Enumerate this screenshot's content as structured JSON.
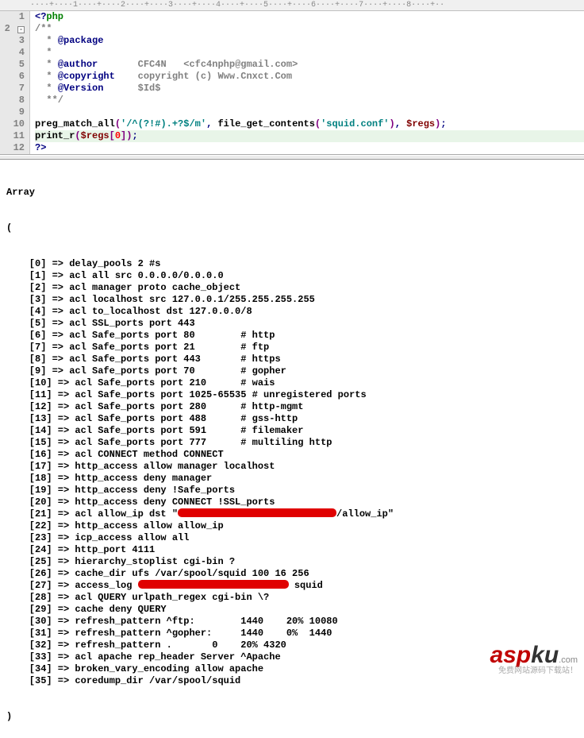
{
  "ruler": "····+····1····+····2····+····3····+····4····+····5····+····6····+····7····+····8····+··",
  "code_lines": [
    {
      "n": "1",
      "html": "<span class='c-op'>&lt;?</span><span class='c-kw'>php</span>"
    },
    {
      "n": "2",
      "fold": true,
      "html": "<span class='c-cmt'>/**</span>"
    },
    {
      "n": "3",
      "html": "<span class='c-cmt'>  * </span><span class='c-tag'>@package</span>"
    },
    {
      "n": "4",
      "html": "<span class='c-cmt'>  *</span>"
    },
    {
      "n": "5",
      "html": "<span class='c-cmt'>  * </span><span class='c-tag'>@author</span><span class='c-cmt'>       CFC4N   &lt;cfc4nphp@gmail.com&gt;</span>"
    },
    {
      "n": "6",
      "html": "<span class='c-cmt'>  * </span><span class='c-tag'>@copyright</span><span class='c-cmt'>    copyright (c) Www.Cnxct.Com</span>"
    },
    {
      "n": "7",
      "html": "<span class='c-cmt'>  * </span><span class='c-tag'>@Version</span><span class='c-cmt'>      $Id$</span>"
    },
    {
      "n": "8",
      "html": "<span class='c-cmt'>  **/</span>"
    },
    {
      "n": "9",
      "html": ""
    },
    {
      "n": "10",
      "html": "<span class='c-fn'>preg_match_all</span><span class='c-br'>(</span><span class='c-str'>'/^(?!#).+?$/m'</span><span class='c-op'>,</span> <span class='c-fn'>file_get_contents</span><span class='c-br'>(</span><span class='c-str'>'squid.conf'</span><span class='c-br'>)</span><span class='c-op'>,</span> <span class='c-var'>$regs</span><span class='c-br'>)</span><span class='c-op'>;</span>"
    },
    {
      "n": "11",
      "hl": true,
      "html": "<span class='c-fn'>print_r</span><span class='c-br'>(</span><span class='c-var'>$regs</span><span class='c-br'>[</span><span class='c-num'>0</span><span class='c-br'>])</span><span class='c-op'>;</span>"
    },
    {
      "n": "12",
      "html": "<span class='c-op'>?&gt;</span>"
    }
  ],
  "output": {
    "head1": "Array",
    "head2": "(",
    "rows": [
      {
        "idx": 0,
        "text": "delay_pools 2 #s"
      },
      {
        "idx": 1,
        "text": "acl all src 0.0.0.0/0.0.0.0"
      },
      {
        "idx": 2,
        "text": "acl manager proto cache_object"
      },
      {
        "idx": 3,
        "text": "acl localhost src 127.0.0.1/255.255.255.255"
      },
      {
        "idx": 4,
        "text": "acl to_localhost dst 127.0.0.0/8"
      },
      {
        "idx": 5,
        "text": "acl SSL_ports port 443"
      },
      {
        "idx": 6,
        "text": "acl Safe_ports port 80        # http"
      },
      {
        "idx": 7,
        "text": "acl Safe_ports port 21        # ftp"
      },
      {
        "idx": 8,
        "text": "acl Safe_ports port 443       # https"
      },
      {
        "idx": 9,
        "text": "acl Safe_ports port 70        # gopher"
      },
      {
        "idx": 10,
        "text": "acl Safe_ports port 210      # wais"
      },
      {
        "idx": 11,
        "text": "acl Safe_ports port 1025-65535 # unregistered ports"
      },
      {
        "idx": 12,
        "text": "acl Safe_ports port 280      # http-mgmt"
      },
      {
        "idx": 13,
        "text": "acl Safe_ports port 488      # gss-http"
      },
      {
        "idx": 14,
        "text": "acl Safe_ports port 591      # filemaker"
      },
      {
        "idx": 15,
        "text": "acl Safe_ports port 777      # multiling http"
      },
      {
        "idx": 16,
        "text": "acl CONNECT method CONNECT"
      },
      {
        "idx": 17,
        "text": "http_access allow manager localhost"
      },
      {
        "idx": 18,
        "text": "http_access deny manager"
      },
      {
        "idx": 19,
        "text": "http_access deny !Safe_ports"
      },
      {
        "idx": 20,
        "text": "http_access deny CONNECT !SSL_ports"
      },
      {
        "idx": 21,
        "pre": "acl allow_ip dst \"",
        "redact": 200,
        "post": "/allow_ip\""
      },
      {
        "idx": 22,
        "text": "http_access allow allow_ip"
      },
      {
        "idx": 23,
        "text": "icp_access allow all"
      },
      {
        "idx": 24,
        "text": "http_port 4111"
      },
      {
        "idx": 25,
        "text": "hierarchy_stoplist cgi-bin ?"
      },
      {
        "idx": 26,
        "text": "cache_dir ufs /var/spool/squid 100 16 256"
      },
      {
        "idx": 27,
        "pre": "access_log ",
        "redact": 190,
        "post": " squid"
      },
      {
        "idx": 28,
        "text": "acl QUERY urlpath_regex cgi-bin \\?"
      },
      {
        "idx": 29,
        "text": "cache deny QUERY"
      },
      {
        "idx": 30,
        "text": "refresh_pattern ^ftp:        1440    20% 10080"
      },
      {
        "idx": 31,
        "text": "refresh_pattern ^gopher:     1440    0%  1440"
      },
      {
        "idx": 32,
        "text": "refresh_pattern .       0    20% 4320"
      },
      {
        "idx": 33,
        "text": "acl apache rep_header Server ^Apache"
      },
      {
        "idx": 34,
        "text": "broken_vary_encoding allow apache"
      },
      {
        "idx": 35,
        "text": "coredump_dir /var/spool/squid"
      }
    ],
    "foot": ")"
  },
  "watermark": {
    "logo_red": "asp",
    "logo_black": "ku",
    "domain": ".com",
    "tagline": "免费网站源码下载站！"
  }
}
